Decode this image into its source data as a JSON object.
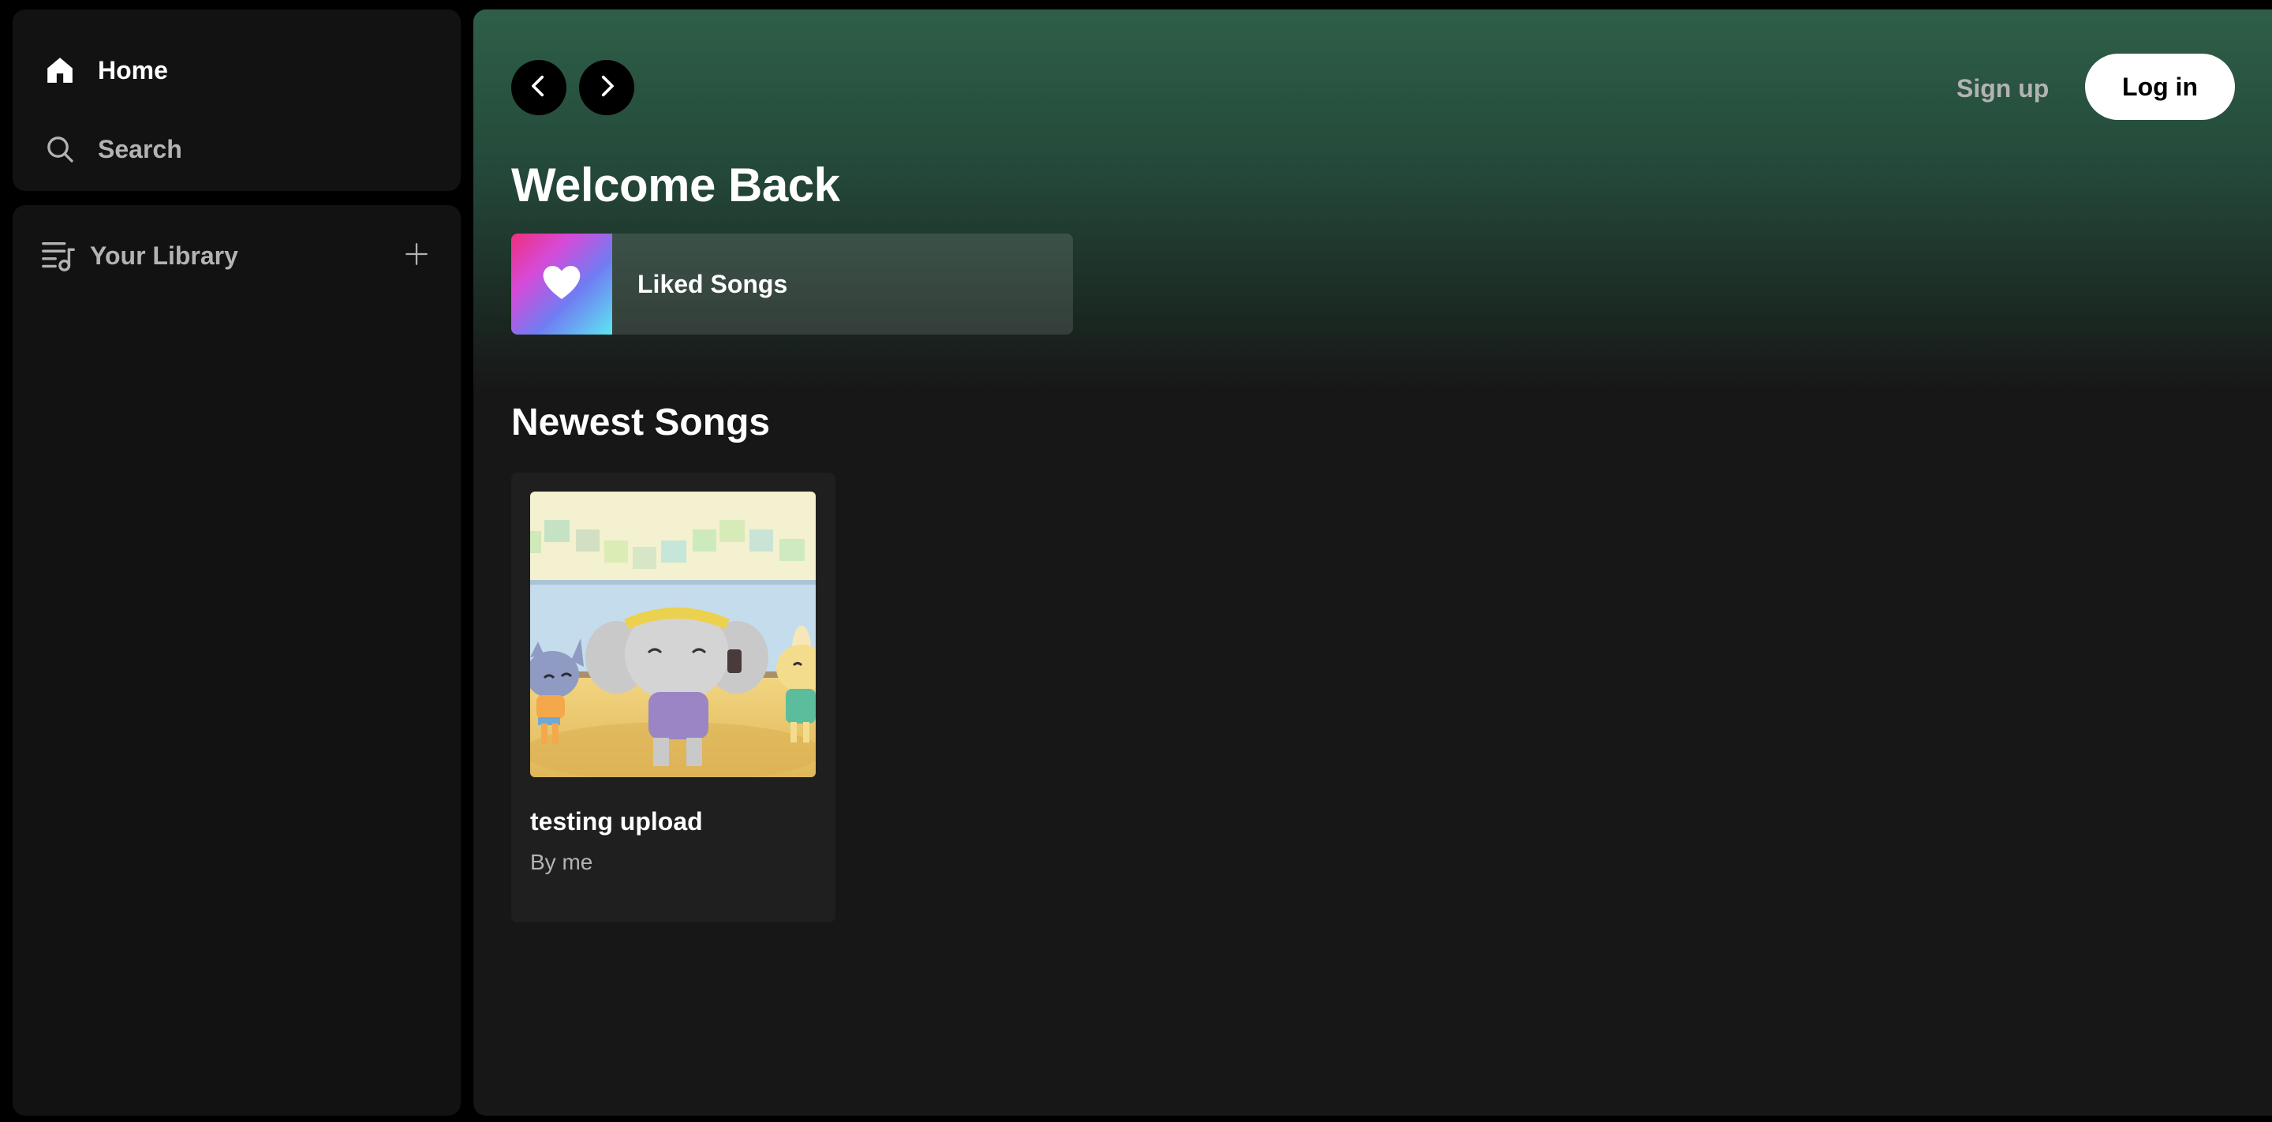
{
  "sidebar": {
    "home_label": "Home",
    "search_label": "Search",
    "library_label": "Your Library"
  },
  "header": {
    "signup_label": "Sign up",
    "login_label": "Log in"
  },
  "main": {
    "welcome_title": "Welcome Back",
    "liked_songs_label": "Liked Songs",
    "newest_title": "Newest Songs",
    "songs": [
      {
        "title": "testing upload",
        "artist": "By me"
      }
    ]
  },
  "icons": {
    "home": "home-icon",
    "search": "search-icon",
    "library": "library-icon",
    "add": "plus-icon",
    "back": "chevron-left-icon",
    "forward": "chevron-right-icon",
    "liked": "heart-icon"
  },
  "colors": {
    "background": "#000000",
    "panel": "#121212",
    "main_gradient_top": "#2e5f48",
    "main_bg": "#171717",
    "card": "#1f1f1f",
    "muted_text": "#b3b3b3",
    "login_bg": "#ffffff"
  }
}
